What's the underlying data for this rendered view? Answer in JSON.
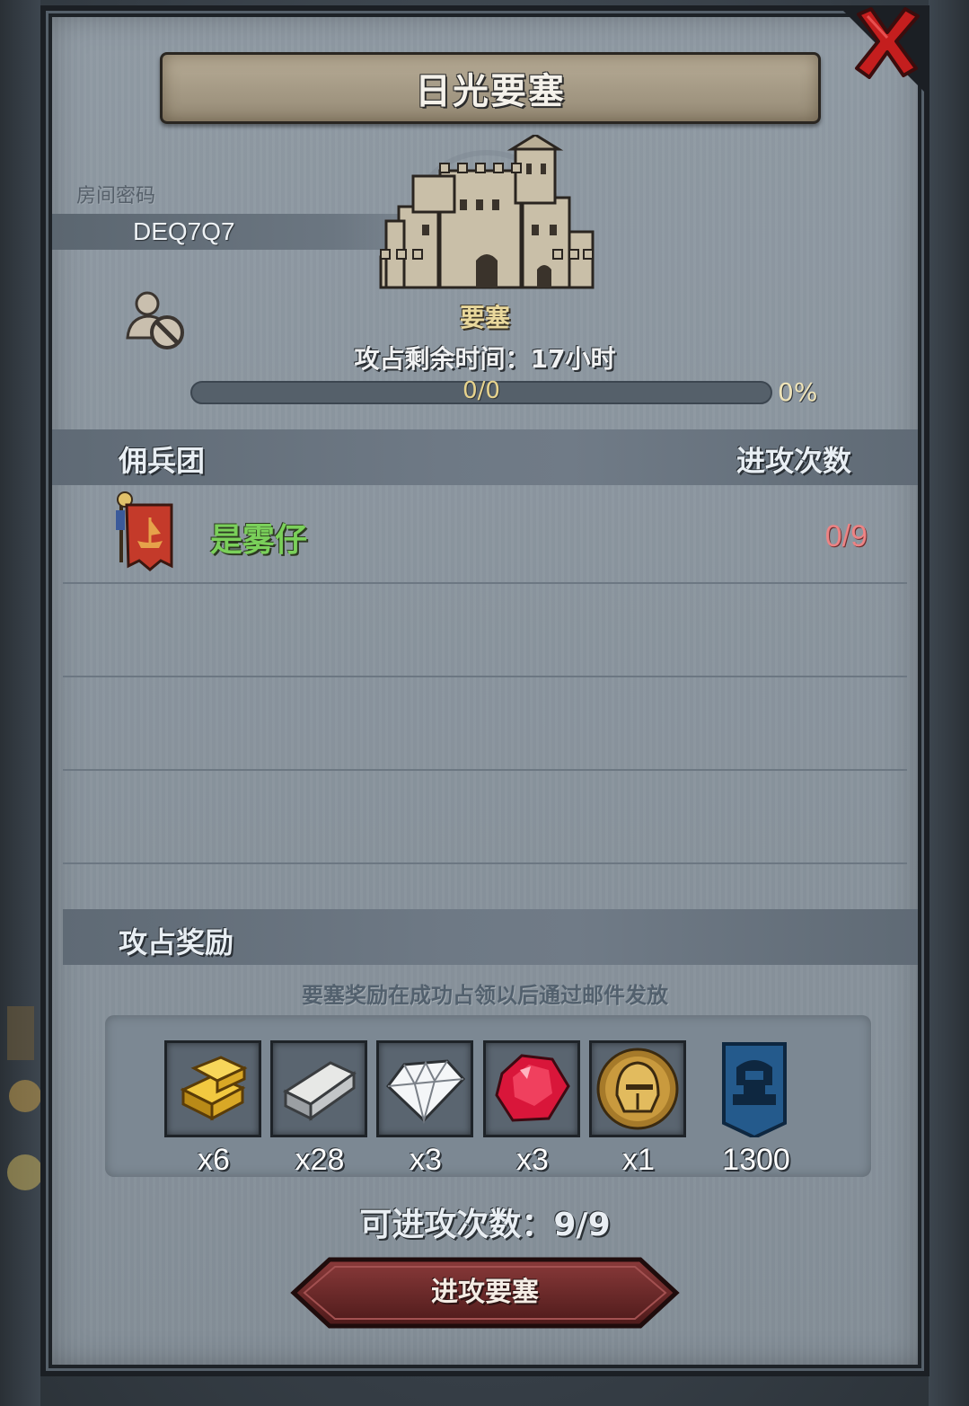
{
  "dialog": {
    "title": "日光要塞",
    "close_icon": "close-x-icon"
  },
  "room": {
    "label": "房间密码",
    "code": "DEQ7Q7"
  },
  "privacy": {
    "icon": "user-blocked-icon"
  },
  "fortress": {
    "icon": "castle-icon",
    "label": "要塞",
    "remaining_time": "攻占剩余时间：17小时",
    "progress_count": "0/0",
    "progress_percent_text": "0%",
    "progress_fraction": 0
  },
  "mercenaries": {
    "title": "佣兵团",
    "attacks_header": "进攻次数",
    "rows": [
      {
        "name": "是雾仔",
        "attacks": "0/9",
        "banner_icon": "guild-banner-icon"
      }
    ]
  },
  "rewards": {
    "title": "攻占奖励",
    "note": "要塞奖励在成功占领以后通过邮件发放",
    "items": [
      {
        "icon": "gold-bars-icon",
        "qty": "x6"
      },
      {
        "icon": "silver-bar-icon",
        "qty": "x28"
      },
      {
        "icon": "diamond-icon",
        "qty": "x3"
      },
      {
        "icon": "ruby-icon",
        "qty": "x3"
      },
      {
        "icon": "knight-helmet-medal-icon",
        "qty": "x1"
      },
      {
        "icon": "fortress-pennant-icon",
        "qty": "1300"
      }
    ]
  },
  "footer": {
    "attacks_left": "可进攻次数：9/9",
    "attack_button": "进攻要塞"
  },
  "colors": {
    "panel_bg": "#8c97a1",
    "title_banner": "#a69b86",
    "guild_name": "#7ad05a",
    "attacks_red": "#ec8384",
    "button_red": "#6e2a2a"
  }
}
